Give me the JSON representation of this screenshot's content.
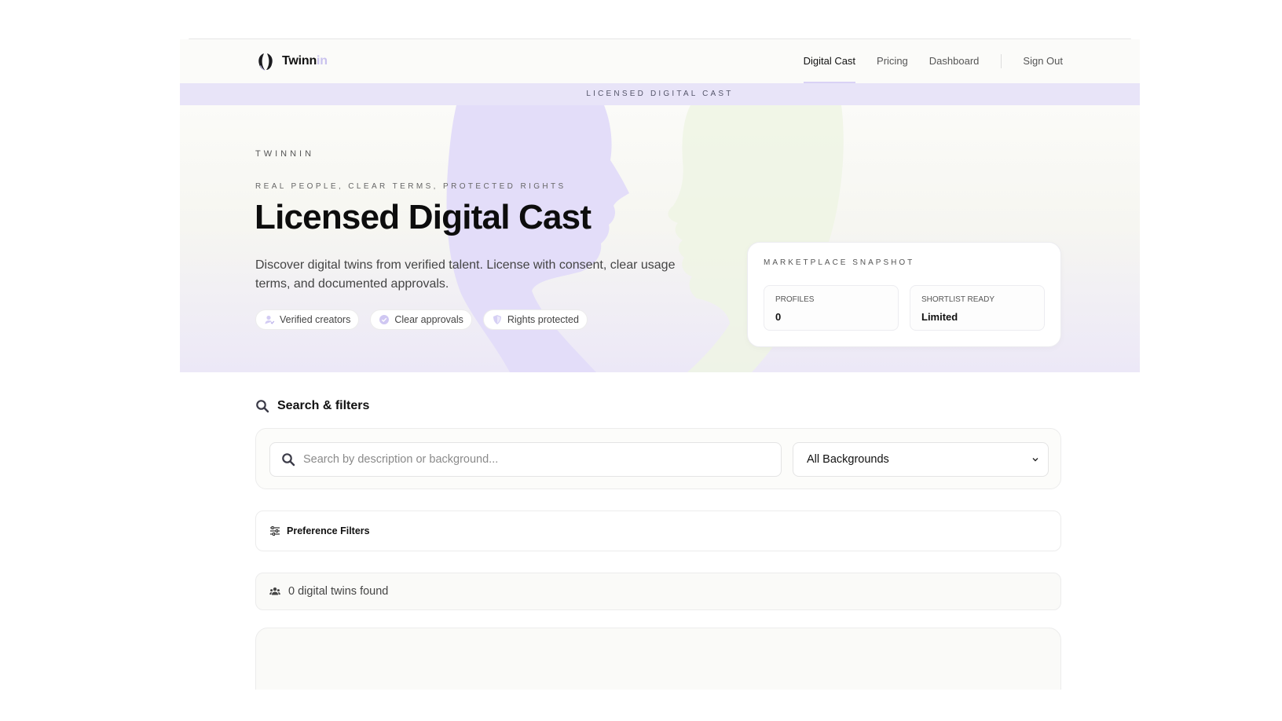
{
  "brand": {
    "name_main": "Twinn",
    "name_fade": "in"
  },
  "nav": {
    "items": [
      {
        "label": "Digital Cast",
        "active": true
      },
      {
        "label": "Pricing",
        "active": false
      },
      {
        "label": "Dashboard",
        "active": false
      }
    ],
    "sign_out": "Sign Out"
  },
  "banner": {
    "text": "LICENSED DIGITAL CAST"
  },
  "hero": {
    "eyebrow": "TWINNIN",
    "tagline": "REAL PEOPLE, CLEAR TERMS, PROTECTED RIGHTS",
    "title": "Licensed Digital Cast",
    "description": "Discover digital twins from verified talent. License with consent, clear usage terms, and documented approvals.",
    "chips": [
      {
        "label": "Verified creators",
        "icon": "verified-user-icon"
      },
      {
        "label": "Clear approvals",
        "icon": "check-circle-icon"
      },
      {
        "label": "Rights protected",
        "icon": "shield-icon"
      }
    ]
  },
  "snapshot": {
    "title": "MARKETPLACE SNAPSHOT",
    "stats": [
      {
        "label": "PROFILES",
        "value": "0"
      },
      {
        "label": "SHORTLIST READY",
        "value": "Limited"
      }
    ]
  },
  "search": {
    "section_title": "Search & filters",
    "placeholder": "Search by description or background...",
    "value": "",
    "background_select": "All Backgrounds"
  },
  "preferences": {
    "label": "Preference Filters"
  },
  "results": {
    "count_text": "0 digital twins found"
  },
  "colors": {
    "accent_lavender": "#e8e4f8",
    "silhouette_purple": "#e3ddf9",
    "silhouette_green": "#eef5e4"
  }
}
